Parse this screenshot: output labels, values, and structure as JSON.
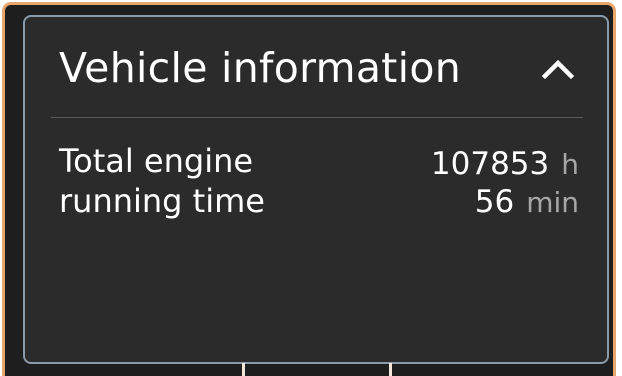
{
  "card": {
    "title": "Vehicle information",
    "collapse_icon": "chevron-up-icon"
  },
  "engine_time": {
    "label_line1": "Total engine",
    "label_line2": "running time",
    "hours_value": "107853",
    "hours_unit": "h",
    "minutes_value": "56",
    "minutes_unit": "min"
  },
  "colors": {
    "frame_border": "#e8a56c",
    "panel_border": "#8a9aa8",
    "panel_background": "#2b2b2b",
    "text_primary": "#ffffff",
    "text_unit": "#a6a6a6"
  }
}
